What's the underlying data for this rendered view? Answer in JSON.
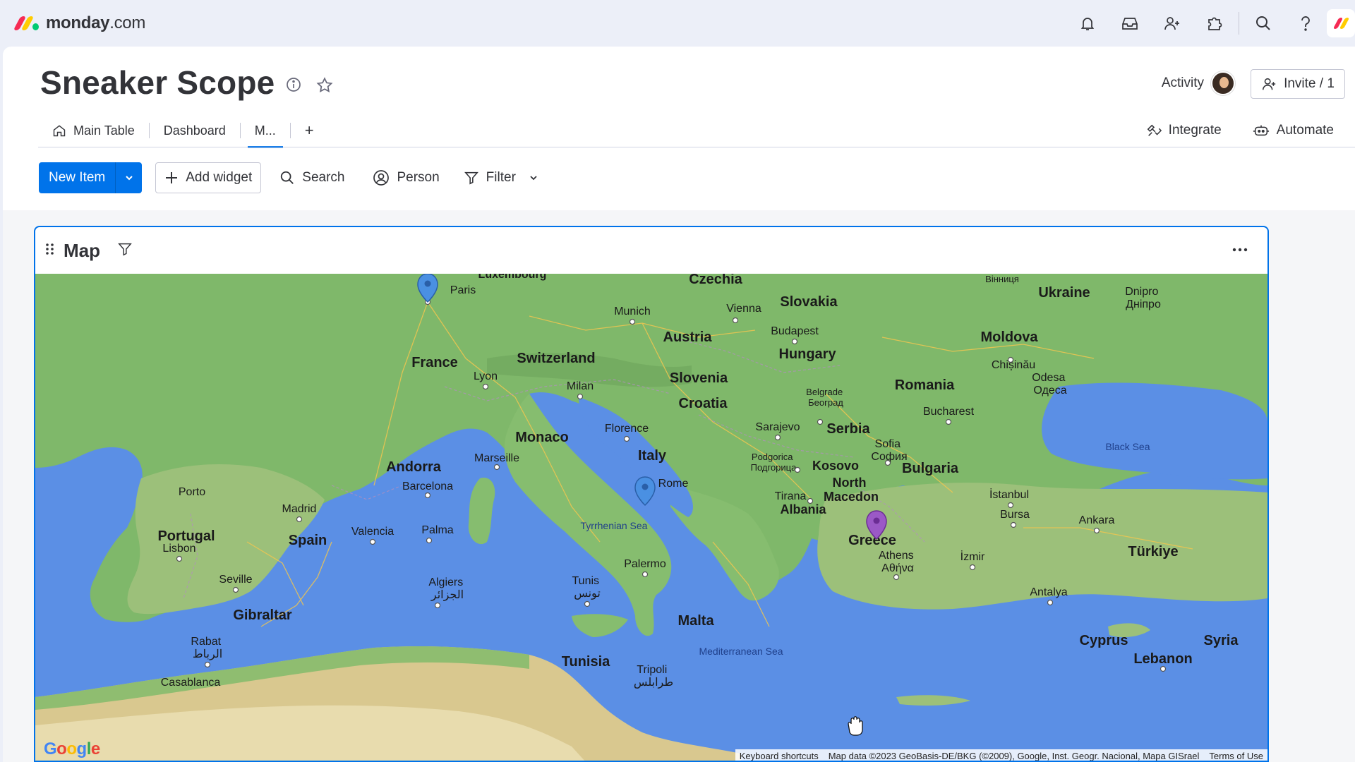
{
  "app": {
    "logo_brand": "monday",
    "logo_suffix": ".com",
    "logo_colors": [
      "#f62b54",
      "#ffcc00",
      "#00ca72"
    ],
    "top_icons": [
      "bell-icon",
      "inbox-icon",
      "invite-members-icon",
      "apps-icon",
      "search-icon",
      "help-icon"
    ]
  },
  "board": {
    "title": "Sneaker Scope",
    "activity_label": "Activity",
    "invite_label": "Invite / 1"
  },
  "tabs": [
    {
      "label": "Main Table",
      "icon": "home-icon"
    },
    {
      "label": "Dashboard"
    },
    {
      "label": "M...",
      "active": true
    },
    {
      "label": "+"
    }
  ],
  "right_tools": {
    "integrate_label": "Integrate",
    "automate_label": "Automate"
  },
  "toolbar": {
    "new_item_label": "New Item",
    "add_widget_label": "Add widget",
    "search_label": "Search",
    "person_label": "Person",
    "filter_label": "Filter"
  },
  "widget": {
    "title": "Map"
  },
  "map": {
    "labels": {
      "czechia": "Czechia",
      "slovakia": "Slovakia",
      "ukraine": "Ukraine",
      "moldova": "Moldova",
      "austria": "Austria",
      "hungary": "Hungary",
      "romania": "Romania",
      "slovenia": "Slovenia",
      "croatia": "Croatia",
      "serbia": "Serbia",
      "bulgaria": "Bulgaria",
      "kosovo": "Kosovo",
      "north_macedonia": "North\nMacedon",
      "albania": "Albania",
      "greece": "Greece",
      "turkiye": "Türkiye",
      "france": "France",
      "switzerland": "Switzerland",
      "monaco": "Monaco",
      "italy": "Italy",
      "andorra": "Andorra",
      "spain": "Spain",
      "portugal": "Portugal",
      "gibraltar": "Gibraltar",
      "malta": "Malta",
      "tunisia": "Tunisia",
      "cyprus": "Cyprus",
      "syria": "Syria",
      "lebanon": "Lebanon",
      "luxembourg": "Luxembourg",
      "paris": "Paris",
      "munich": "Munich",
      "vienna": "Vienna",
      "budapest": "Budapest",
      "vinnytsia": "Вінниця",
      "dnipro": "Dnipro\nДніпро",
      "chisinau": "Chișinău",
      "odesa": "Odesa\nОдеса",
      "lyon": "Lyon",
      "milan": "Milan",
      "belgrade": "Belgrade\nБеоград",
      "bucharest": "Bucharest",
      "florence": "Florence",
      "sarajevo": "Sarajevo",
      "sofia": "Sofia\nСофия",
      "marseille": "Marseille",
      "podgorica": "Podgorica\nПодгорица",
      "rome": "Rome",
      "istanbul": "İstanbul",
      "barcelona": "Barcelona",
      "tirana": "Tirana",
      "porto": "Porto",
      "madrid": "Madrid",
      "valencia": "Valencia",
      "palma": "Palma",
      "bursa": "Bursa",
      "ankara": "Ankara",
      "lisbon": "Lisbon",
      "athens": "Athens\nΑθήνα",
      "izmir": "İzmir",
      "seville": "Seville",
      "algiers": "Algiers\nالجزائر",
      "tunis": "Tunis\nتونس",
      "palermo": "Palermo",
      "antalya": "Antalya",
      "rabat": "Rabat\nالرباط",
      "casablanca": "Casablanca",
      "tripoli": "Tripoli\nطرابلس",
      "black_sea": "Black Sea",
      "tyrrhenian_sea": "Tyrrhenian Sea",
      "mediterranean_sea": "Mediterranean Sea"
    },
    "pins": [
      {
        "name": "paris-pin",
        "color": "#4a90e2"
      },
      {
        "name": "rome-pin",
        "color": "#4a90e2"
      },
      {
        "name": "thessaloniki-pin",
        "color": "#9b59c6"
      }
    ],
    "footer": {
      "shortcuts": "Keyboard shortcuts",
      "attribution": "Map data ©2023 GeoBasis-DE/BKG (©2009), Google, Inst. Geogr. Nacional, Mapa GISrael",
      "terms": "Terms of Use"
    },
    "google_logo": "Google"
  }
}
